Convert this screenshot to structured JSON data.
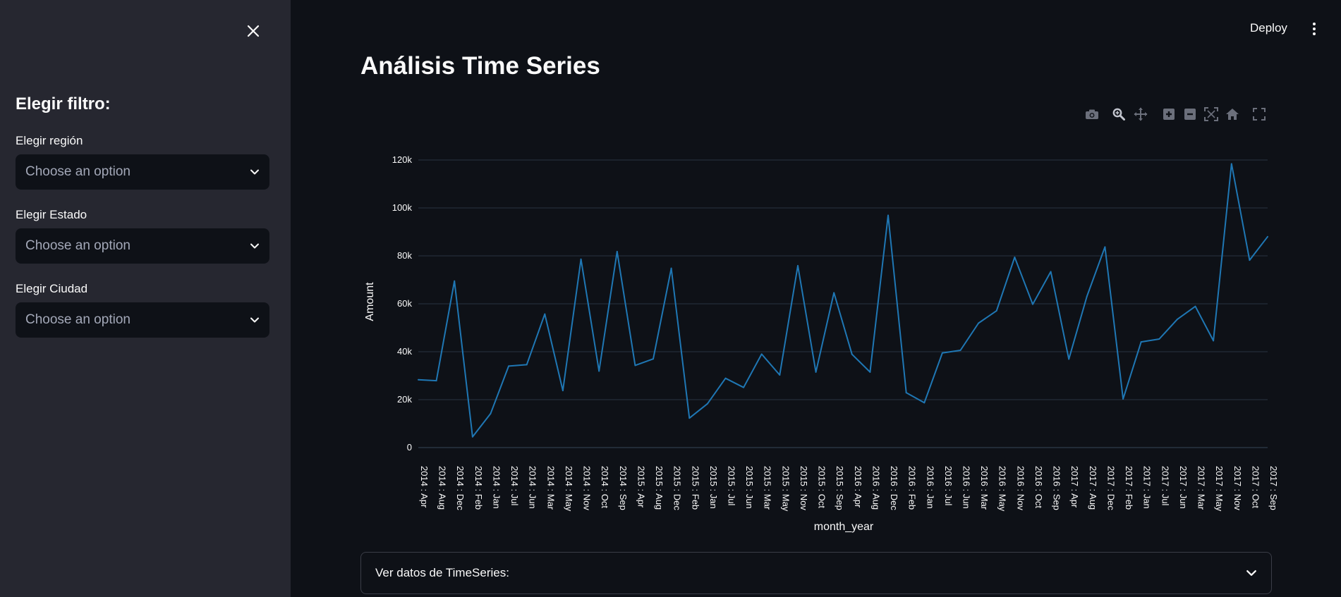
{
  "header": {
    "deploy_label": "Deploy"
  },
  "sidebar": {
    "heading": "Elegir filtro:",
    "filters": [
      {
        "label": "Elegir región",
        "placeholder": "Choose an option"
      },
      {
        "label": "Elegir Estado",
        "placeholder": "Choose an option"
      },
      {
        "label": "Elegir Ciudad",
        "placeholder": "Choose an option"
      }
    ]
  },
  "main": {
    "title": "Análisis Time Series",
    "expander_label": "Ver datos de TimeSeries:"
  },
  "modebar": [
    "camera-icon",
    "zoom-icon",
    "pan-icon",
    "zoom-in-icon",
    "zoom-out-icon",
    "autoscale-icon",
    "reset-axes-icon",
    "fullscreen-icon"
  ],
  "colors": {
    "line": "#1f77b4",
    "grid": "#283442",
    "sidebar": "#262730",
    "background": "#0e1117"
  },
  "chart_data": {
    "type": "line",
    "xlabel": "month_year",
    "ylabel": "Amount",
    "ylim": [
      0,
      125000
    ],
    "yticks": [
      0,
      20000,
      40000,
      60000,
      80000,
      100000,
      120000
    ],
    "ytick_labels": [
      "0",
      "20k",
      "40k",
      "60k",
      "80k",
      "100k",
      "120k"
    ],
    "grid": true,
    "categories": [
      "2014 : Apr",
      "2014 : Aug",
      "2014 : Dec",
      "2014 : Feb",
      "2014 : Jan",
      "2014 : Jul",
      "2014 : Jun",
      "2014 : Mar",
      "2014 : May",
      "2014 : Nov",
      "2014 : Oct",
      "2014 : Sep",
      "2015 : Apr",
      "2015 : Aug",
      "2015 : Dec",
      "2015 : Feb",
      "2015 : Jan",
      "2015 : Jul",
      "2015 : Jun",
      "2015 : Mar",
      "2015 : May",
      "2015 : Nov",
      "2015 : Oct",
      "2015 : Sep",
      "2016 : Apr",
      "2016 : Aug",
      "2016 : Dec",
      "2016 : Feb",
      "2016 : Jan",
      "2016 : Jul",
      "2016 : Jun",
      "2016 : Mar",
      "2016 : May",
      "2016 : Nov",
      "2016 : Oct",
      "2016 : Sep",
      "2017 : Apr",
      "2017 : Aug",
      "2017 : Dec",
      "2017 : Feb",
      "2017 : Jan",
      "2017 : Jul",
      "2017 : Jun",
      "2017 : Mar",
      "2017 : May",
      "2017 : Nov",
      "2017 : Oct",
      "2017 : Sep"
    ],
    "series": [
      {
        "values": [
          28300,
          27900,
          69500,
          4500,
          14200,
          34000,
          34600,
          55700,
          23800,
          78600,
          31900,
          81800,
          34300,
          37000,
          74800,
          12300,
          18300,
          28900,
          25100,
          39000,
          30300,
          75900,
          31500,
          64600,
          38900,
          31500,
          96900,
          22900,
          18700,
          39500,
          40600,
          51900,
          57100,
          79400,
          59800,
          73400,
          36900,
          63100,
          83700,
          20300,
          44100,
          45300,
          53500,
          58900,
          44600,
          118400,
          78200,
          88000
        ]
      }
    ]
  }
}
